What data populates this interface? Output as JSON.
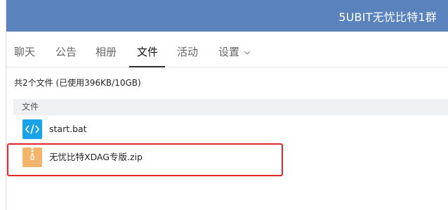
{
  "window": {
    "title": "5UBIT无忧比特1群"
  },
  "tabs": [
    {
      "label": "聊天",
      "active": false
    },
    {
      "label": "公告",
      "active": false
    },
    {
      "label": "相册",
      "active": false
    },
    {
      "label": "文件",
      "active": true
    },
    {
      "label": "活动",
      "active": false
    },
    {
      "label": "设置",
      "active": false,
      "dropdown": true
    }
  ],
  "files": {
    "summary": "共2个文件 (已使用396KB/10GB)",
    "column_header": "文件",
    "items": [
      {
        "name": "start.bat",
        "icon": "code-file-icon",
        "color": "#1aa3e8"
      },
      {
        "name": "无忧比特XDAG专版.zip",
        "icon": "zip-archive-icon",
        "color": "#f2b56b"
      }
    ]
  },
  "annotation": {
    "color": "#e3262a"
  }
}
